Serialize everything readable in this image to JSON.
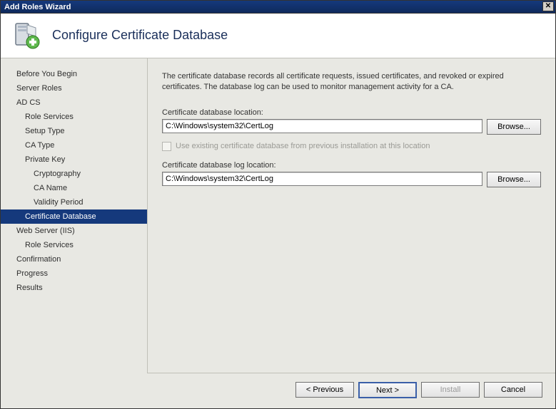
{
  "window": {
    "title": "Add Roles Wizard"
  },
  "header": {
    "title": "Configure Certificate Database"
  },
  "sidebar": {
    "items": [
      {
        "label": "Before You Begin",
        "indent": 0
      },
      {
        "label": "Server Roles",
        "indent": 0
      },
      {
        "label": "AD CS",
        "indent": 0
      },
      {
        "label": "Role Services",
        "indent": 1
      },
      {
        "label": "Setup Type",
        "indent": 1
      },
      {
        "label": "CA Type",
        "indent": 1
      },
      {
        "label": "Private Key",
        "indent": 1
      },
      {
        "label": "Cryptography",
        "indent": 2
      },
      {
        "label": "CA Name",
        "indent": 2
      },
      {
        "label": "Validity Period",
        "indent": 2
      },
      {
        "label": "Certificate Database",
        "indent": 1,
        "selected": true
      },
      {
        "label": "Web Server (IIS)",
        "indent": 0
      },
      {
        "label": "Role Services",
        "indent": 1
      },
      {
        "label": "Confirmation",
        "indent": 0
      },
      {
        "label": "Progress",
        "indent": 0
      },
      {
        "label": "Results",
        "indent": 0
      }
    ]
  },
  "main": {
    "description": "The certificate database records all certificate requests, issued certificates, and revoked or expired certificates. The database log can be used to monitor management activity for a CA.",
    "db_location_label": "Certificate database location:",
    "db_location_value": "C:\\Windows\\system32\\CertLog",
    "browse1": "Browse...",
    "use_existing_label": "Use existing certificate database from previous installation at this location",
    "log_location_label": "Certificate database log location:",
    "log_location_value": "C:\\Windows\\system32\\CertLog",
    "browse2": "Browse..."
  },
  "footer": {
    "previous": "< Previous",
    "next": "Next >",
    "install": "Install",
    "cancel": "Cancel"
  }
}
